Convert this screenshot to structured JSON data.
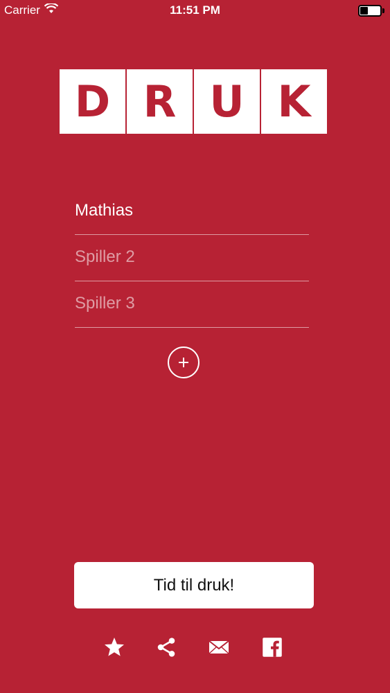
{
  "status_bar": {
    "carrier": "Carrier",
    "time": "11:51 PM",
    "wifi_icon": "wifi-icon",
    "battery_icon": "battery-icon"
  },
  "logo": {
    "letters": [
      "D",
      "R",
      "U",
      "K"
    ]
  },
  "players": [
    {
      "value": "Mathias",
      "placeholder": ""
    },
    {
      "value": "",
      "placeholder": "Spiller 2"
    },
    {
      "value": "",
      "placeholder": "Spiller 3"
    }
  ],
  "add_player_icon": "plus-circle-icon",
  "start_button": {
    "label": "Tid til druk!"
  },
  "bottom_icons": [
    "star-icon",
    "share-icon",
    "mail-icon",
    "facebook-icon"
  ],
  "colors": {
    "background": "#B72234",
    "text": "#FFFFFF",
    "button_bg": "#FFFFFF",
    "button_text": "#111111"
  }
}
